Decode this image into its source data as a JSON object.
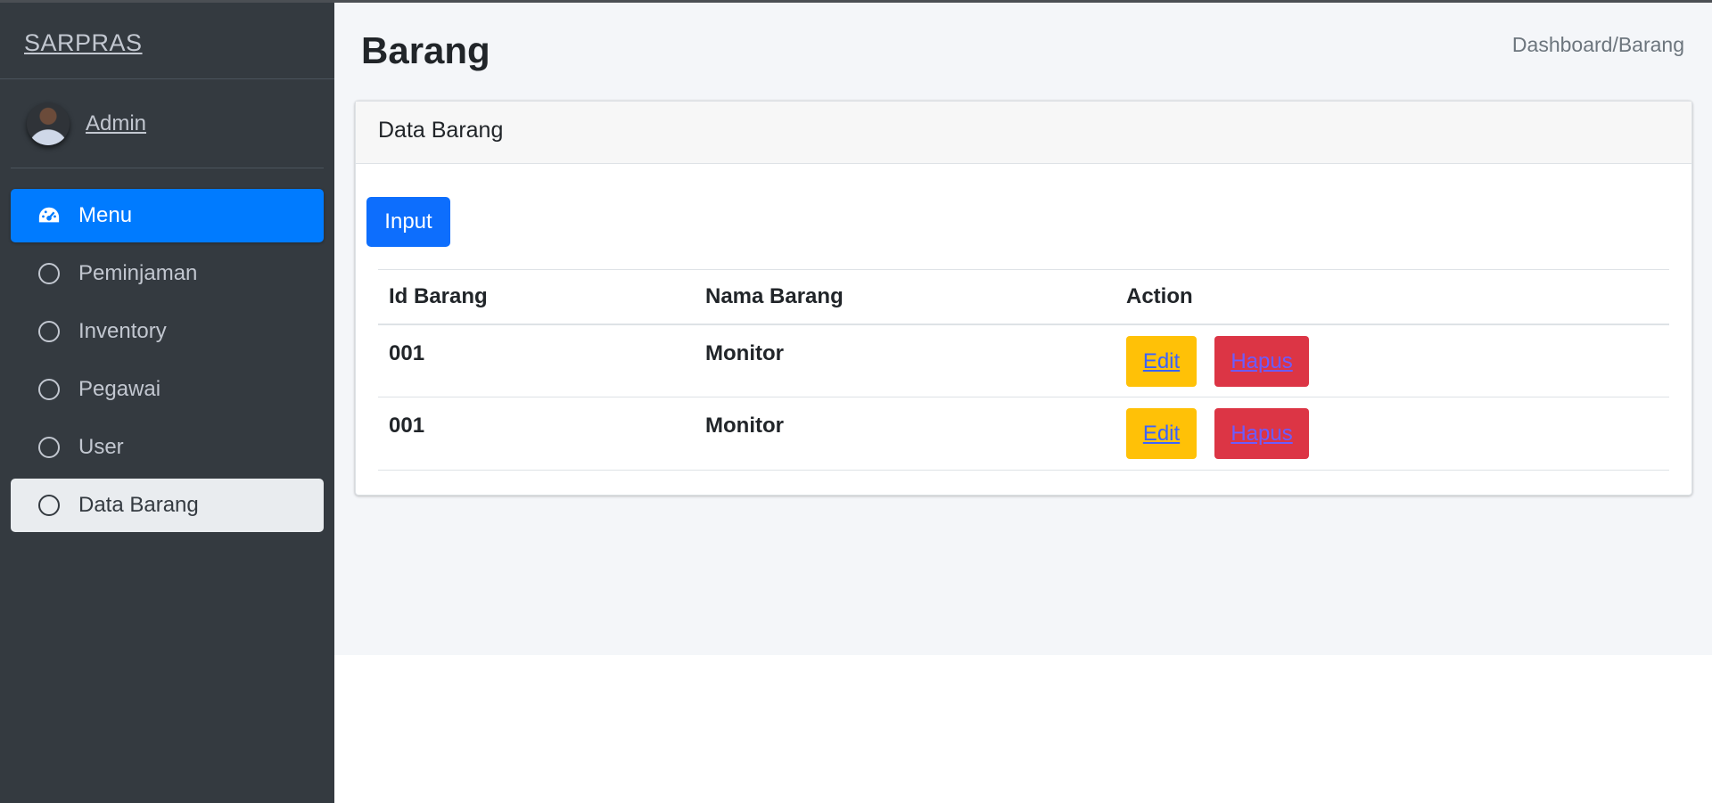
{
  "sidebar": {
    "brand": "SARPRAS",
    "user": {
      "name": "Admin"
    },
    "items": [
      {
        "label": "Menu",
        "icon": "tachometer-icon",
        "state": "active"
      },
      {
        "label": "Peminjaman",
        "icon": "circle-icon"
      },
      {
        "label": "Inventory",
        "icon": "circle-icon"
      },
      {
        "label": "Pegawai",
        "icon": "circle-icon"
      },
      {
        "label": "User",
        "icon": "circle-icon"
      },
      {
        "label": "Data Barang",
        "icon": "circle-icon",
        "state": "current"
      }
    ]
  },
  "header": {
    "title": "Barang",
    "breadcrumb": "Dashboard/Barang"
  },
  "card": {
    "title": "Data Barang",
    "input_button": "Input",
    "table": {
      "columns": [
        "Id Barang",
        "Nama Barang",
        "Action"
      ],
      "rows": [
        {
          "id": "001",
          "name": "Monitor",
          "edit": "Edit",
          "delete": "Hapus"
        },
        {
          "id": "001",
          "name": "Monitor",
          "edit": "Edit",
          "delete": "Hapus"
        }
      ]
    }
  },
  "colors": {
    "sidebar_bg": "#343a40",
    "active_item": "#007bff",
    "input_button": "#0d6efd",
    "edit_button": "#ffc107",
    "delete_button": "#dc3545"
  }
}
